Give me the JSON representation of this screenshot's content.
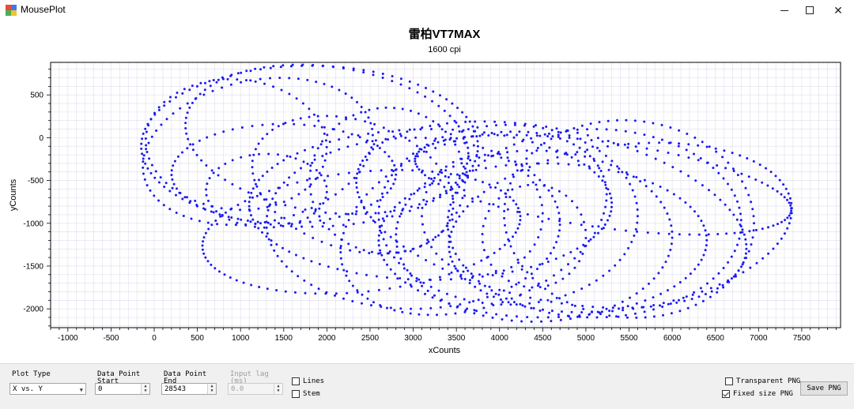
{
  "window": {
    "title": "MousePlot",
    "icons": {
      "app": "app-icon",
      "minimize": "minimize-icon",
      "maximize": "maximize-icon",
      "close": "close-icon"
    },
    "close_glyph": "✕"
  },
  "chart_data": {
    "type": "scatter",
    "title": "雷柏VT7MAX",
    "subtitle": "1600 cpi",
    "xlabel": "xCounts",
    "ylabel": "yCounts",
    "xlim": [
      -1200,
      7950
    ],
    "ylim": [
      -2220,
      880
    ],
    "x_ticks": [
      -1000,
      -500,
      0,
      500,
      1000,
      1500,
      2000,
      2500,
      3000,
      3500,
      4000,
      4500,
      5000,
      5500,
      6000,
      6500,
      7000,
      7500
    ],
    "y_ticks": [
      500,
      0,
      -500,
      -1000,
      -1500,
      -2000
    ],
    "x_tick_labels": [
      "-1000",
      "-500",
      "0",
      "500",
      "1000",
      "1500",
      "2000",
      "2500",
      "3000",
      "3500",
      "4000",
      "4500",
      "5000",
      "5500",
      "6000",
      "6500",
      "7000",
      "7500"
    ],
    "y_tick_labels": [
      "500",
      "0",
      "-500",
      "-1000",
      "-1500",
      "-2000"
    ],
    "grid": true,
    "point_color": "#1a1af0",
    "grid_color": "#dcdcf0",
    "loops": [
      {
        "cx": 1800,
        "cy": -100,
        "rx": 1950,
        "ry": 940,
        "rot": 0
      },
      {
        "cx": 2000,
        "cy": -20,
        "rx": 1650,
        "ry": 850,
        "rot": -8
      },
      {
        "cx": 1200,
        "cy": -160,
        "rx": 1350,
        "ry": 830,
        "rot": 12
      },
      {
        "cx": 950,
        "cy": -80,
        "rx": 1050,
        "ry": 760,
        "rot": -5
      },
      {
        "cx": 1500,
        "cy": -420,
        "rx": 1300,
        "ry": 580,
        "rot": 0
      },
      {
        "cx": 1300,
        "cy": -620,
        "rx": 700,
        "ry": 430,
        "rot": 0
      },
      {
        "cx": 2300,
        "cy": -550,
        "rx": 1200,
        "ry": 750,
        "rot": -18
      },
      {
        "cx": 2700,
        "cy": -500,
        "rx": 900,
        "ry": 850,
        "rot": 5
      },
      {
        "cx": 2400,
        "cy": -1100,
        "rx": 1850,
        "ry": 700,
        "rot": 6
      },
      {
        "cx": 3000,
        "cy": -1000,
        "rx": 1700,
        "ry": 1000,
        "rot": 0
      },
      {
        "cx": 3200,
        "cy": -780,
        "rx": 2100,
        "ry": 880,
        "rot": 0
      },
      {
        "cx": 3700,
        "cy": -1000,
        "rx": 1600,
        "ry": 980,
        "rot": 20
      },
      {
        "cx": 4100,
        "cy": -900,
        "rx": 1500,
        "ry": 1050,
        "rot": 0
      },
      {
        "cx": 4500,
        "cy": -1200,
        "rx": 1900,
        "ry": 900,
        "rot": 0
      },
      {
        "cx": 4600,
        "cy": -900,
        "rx": 2300,
        "ry": 1000,
        "rot": -12
      },
      {
        "cx": 4400,
        "cy": -1150,
        "rx": 1600,
        "ry": 1000,
        "rot": 0
      },
      {
        "cx": 5100,
        "cy": -1000,
        "rx": 1700,
        "ry": 1100,
        "rot": 0
      },
      {
        "cx": 5400,
        "cy": -1050,
        "rx": 2000,
        "ry": 960,
        "rot": 8
      },
      {
        "cx": 5500,
        "cy": -950,
        "rx": 1450,
        "ry": 1150,
        "rot": -6
      },
      {
        "cx": 4400,
        "cy": -1150,
        "rx": 600,
        "ry": 600,
        "rot": 0
      },
      {
        "cx": 3800,
        "cy": -900,
        "rx": 700,
        "ry": 700,
        "rot": 0
      },
      {
        "cx": 5200,
        "cy": -550,
        "rx": 2200,
        "ry": 500,
        "rot": -8
      }
    ]
  },
  "controls": {
    "plot_type_label": "Plot Type",
    "plot_type_value": "X vs. Y",
    "start_label": "Data Point\nStart",
    "start_value": "0",
    "end_label": "Data Point\nEnd",
    "end_value": "28543",
    "lag_label": "Input lag\n(ms)",
    "lag_value": "0.0",
    "lines_label": "Lines",
    "stem_label": "Stem",
    "transparent_label": "Transparent PNG",
    "fixed_label": "Fixed size PNG",
    "save_label": "Save PNG",
    "fixed_checked": true
  }
}
